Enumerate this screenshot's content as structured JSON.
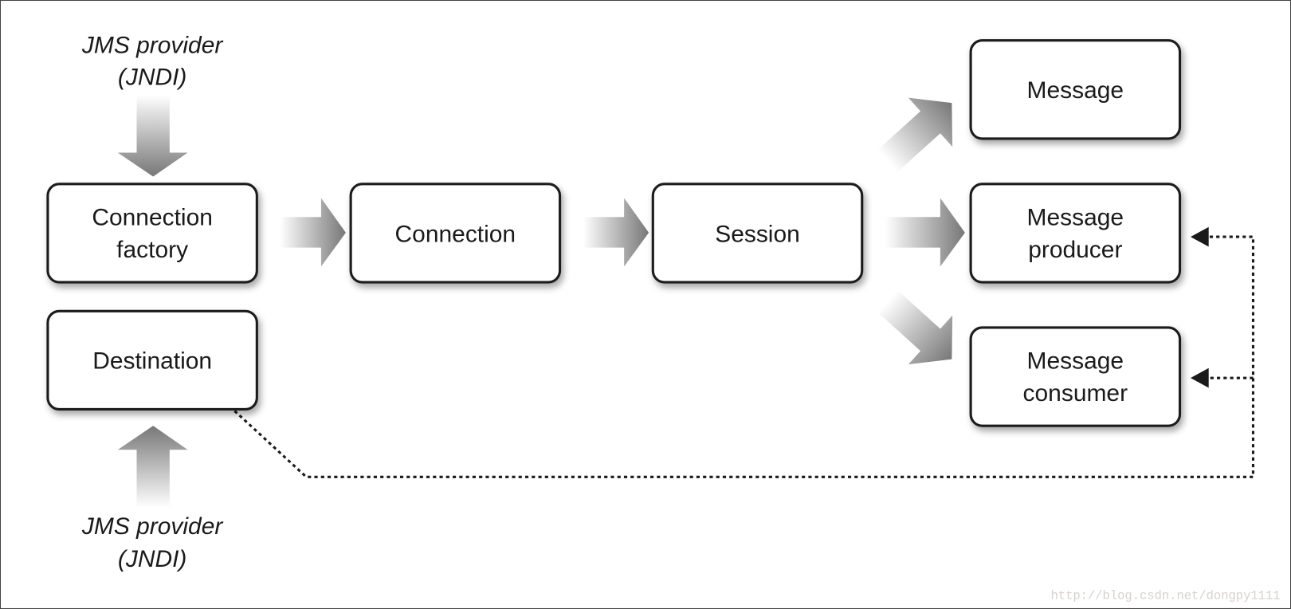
{
  "diagram": {
    "provider_top": [
      "JMS provider",
      "(JNDI)"
    ],
    "provider_bottom": [
      "JMS provider",
      "(JNDI)"
    ],
    "nodes": {
      "connection_factory": [
        "Connection",
        "factory"
      ],
      "destination": [
        "Destination"
      ],
      "connection": [
        "Connection"
      ],
      "session": [
        "Session"
      ],
      "message": [
        "Message"
      ],
      "message_producer": [
        "Message",
        "producer"
      ],
      "message_consumer": [
        "Message",
        "consumer"
      ]
    },
    "watermark": "http://blog.csdn.net/dongpy1111",
    "colors": {
      "box_stroke": "#1a1a1a",
      "arrow_dark": "#7a7a7a",
      "arrow_light": "#ffffff"
    }
  }
}
